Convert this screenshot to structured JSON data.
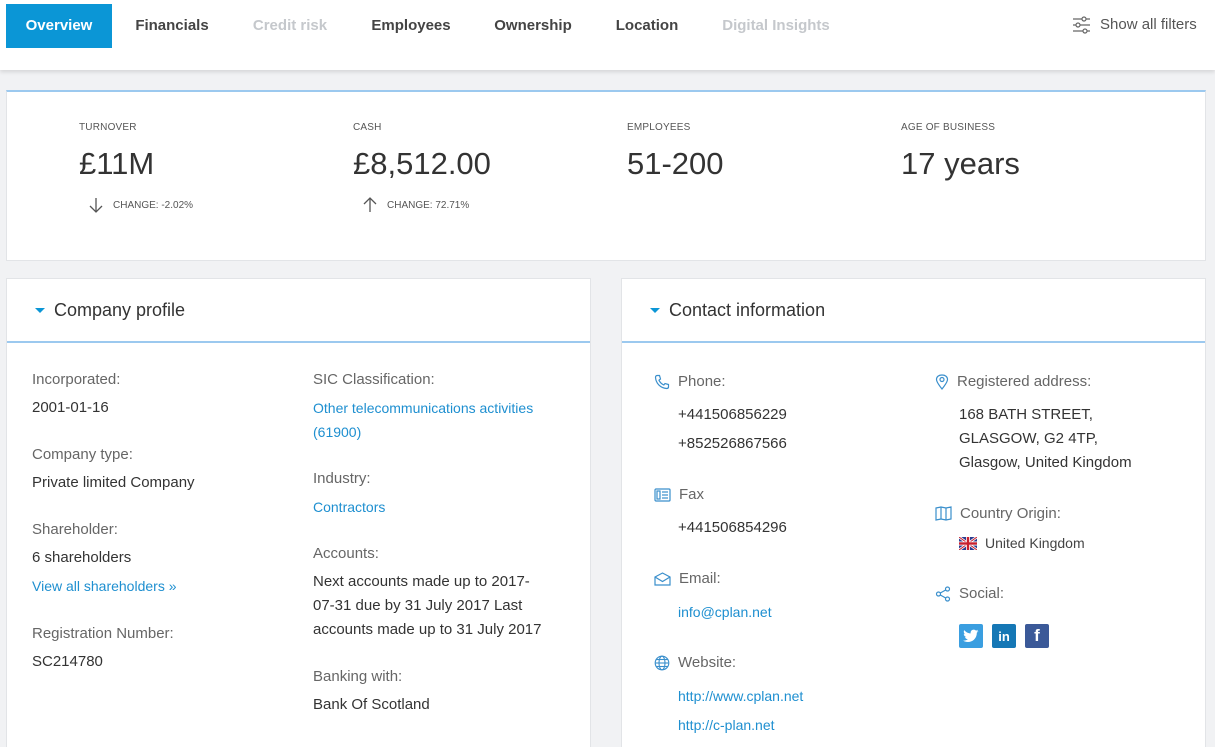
{
  "nav": {
    "tabs": [
      "Overview",
      "Financials",
      "Credit risk",
      "Employees",
      "Ownership",
      "Location",
      "Digital Insights"
    ],
    "filters_label": "Show all filters"
  },
  "kpi": {
    "turnover": {
      "label": "TURNOVER",
      "value": "£11M",
      "change": "CHANGE: -2.02%"
    },
    "cash": {
      "label": "CASH",
      "value": "£8,512.00",
      "change": "CHANGE: 72.71%"
    },
    "employees": {
      "label": "EMPLOYEES",
      "value": "51-200"
    },
    "age": {
      "label": "AGE OF BUSINESS",
      "value": "17 years"
    }
  },
  "profile": {
    "title": "Company profile",
    "incorporated_label": "Incorporated:",
    "incorporated": "2001-01-16",
    "type_label": "Company type:",
    "type": "Private limited Company",
    "shareholder_label": "Shareholder:",
    "shareholders": "6 shareholders",
    "view_shareholders": "View all shareholders »",
    "reg_label": "Registration Number:",
    "reg": "SC214780",
    "sic_label": "SIC Classification:",
    "sic_line1": "Other telecommunications activities",
    "sic_line2": "(61900)",
    "industry_label": "Industry:",
    "industry": "Contractors",
    "accounts_label": "Accounts:",
    "accounts_line1": "Next accounts made up to 2017-",
    "accounts_line2": "07-31 due by 31 July 2017 Last",
    "accounts_line3": "accounts made up to 31 July 2017",
    "banking_label": "Banking with:",
    "banking": "Bank Of Scotland"
  },
  "contact": {
    "title": "Contact information",
    "phone_label": "Phone:",
    "phone1": "+441506856229",
    "phone2": "+852526867566",
    "fax_label": "Fax",
    "fax": "+441506854296",
    "email_label": "Email:",
    "email": "info@cplan.net",
    "website_label": "Website:",
    "website1": "http://www.cplan.net",
    "website2": "http://c-plan.net",
    "address_label": "Registered address:",
    "address_line1": "168 BATH STREET,",
    "address_line2": "GLASGOW, G2 4TP,",
    "address_line3": "Glasgow, United Kingdom",
    "country_label": "Country Origin:",
    "country": "United Kingdom",
    "social_label": "Social:"
  }
}
